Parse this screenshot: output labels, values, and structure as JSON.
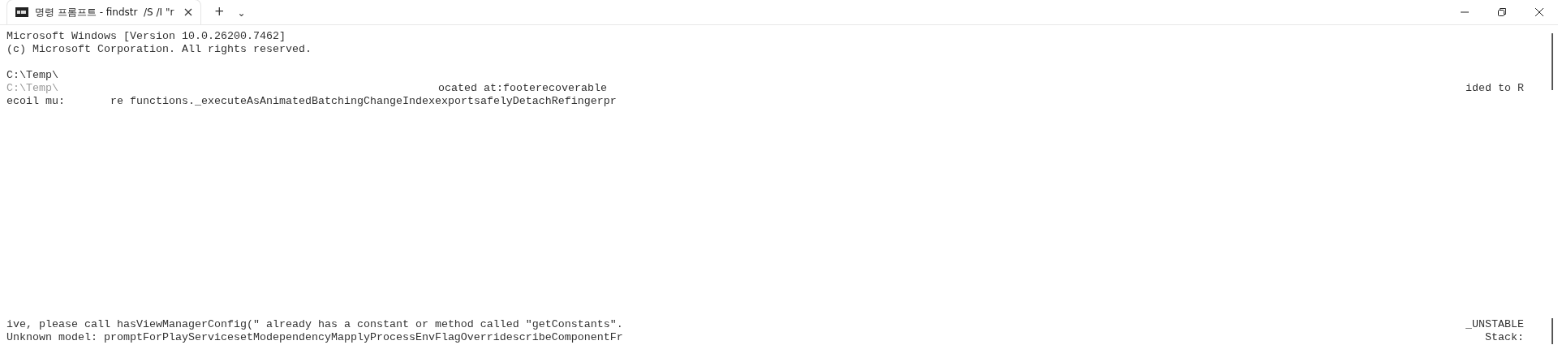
{
  "window": {
    "tab": {
      "title": "명령 프롬프트 - findstr  /S /I \"r",
      "selected": true
    },
    "new_tab": "+",
    "dropdown": "⌄"
  },
  "top_lines": [
    {
      "segments": [
        {
          "text": "Microsoft Windows [Version 10.0.26200.7462]",
          "faded": false
        }
      ]
    },
    {
      "segments": [
        {
          "text": "(c) Microsoft Corporation. All rights reserved.",
          "faded": false
        }
      ]
    },
    {
      "blank_line_before": true,
      "segments": [
        {
          "text": "C:\\Temp\\",
          "faded": false
        }
      ]
    },
    {
      "segments": [
        {
          "text": "C:\\Temp\\",
          "faded": true
        },
        {
          "text": "ocated at:footerecoverable",
          "faded": false
        },
        {
          "text": "ided to R",
          "faded": false
        }
      ]
    },
    {
      "segments": [
        {
          "text": "ecoil mu:",
          "faded": false
        },
        {
          "text": "re functions._executeAsAnimatedBatchingChangeIndexexportsafelyDetachRefingerpr",
          "faded": false
        }
      ]
    }
  ],
  "bottom_lines": [
    {
      "segments": [
        {
          "text": "ive, please call hasViewManagerConfig(\" already has a constant or method called \"getConstants\".",
          "faded": false
        },
        {
          "text": "_UNSTABLE",
          "faded": false
        }
      ]
    },
    {
      "segments": [
        {
          "text": "Unknown model: promptForPlayServicesetModependencyMapplyProcessEnvFlagOverridescribeComponentFr",
          "faded": false
        },
        {
          "text": "Stack:",
          "faded": false
        }
      ]
    }
  ]
}
